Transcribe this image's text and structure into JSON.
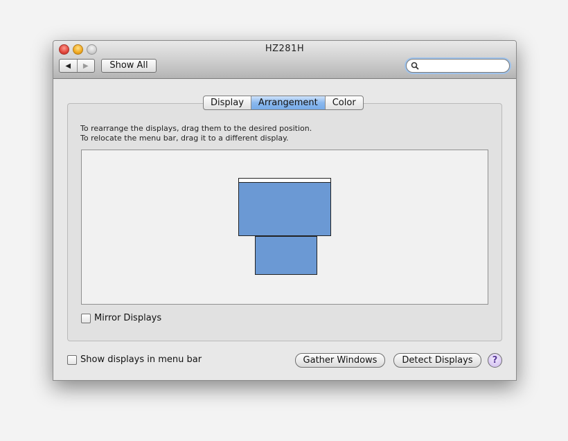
{
  "window": {
    "title": "HZ281H"
  },
  "toolbar": {
    "back_icon": "◀",
    "forward_icon": "▶",
    "show_all_label": "Show All",
    "search_placeholder": ""
  },
  "tabs": [
    {
      "label": "Display",
      "active": false
    },
    {
      "label": "Arrangement",
      "active": true
    },
    {
      "label": "Color",
      "active": false
    }
  ],
  "instructions": {
    "line1": "To rearrange the displays, drag them to the desired position.",
    "line2": "To relocate the menu bar, drag it to a different display."
  },
  "arrangement": {
    "display_color": "#6b99d4"
  },
  "mirror": {
    "label": "Mirror Displays",
    "checked": false
  },
  "footer": {
    "show_in_menu_bar_label": "Show displays in menu bar",
    "show_in_menu_bar_checked": false,
    "gather_windows_label": "Gather Windows",
    "detect_displays_label": "Detect Displays",
    "help_label": "?"
  }
}
